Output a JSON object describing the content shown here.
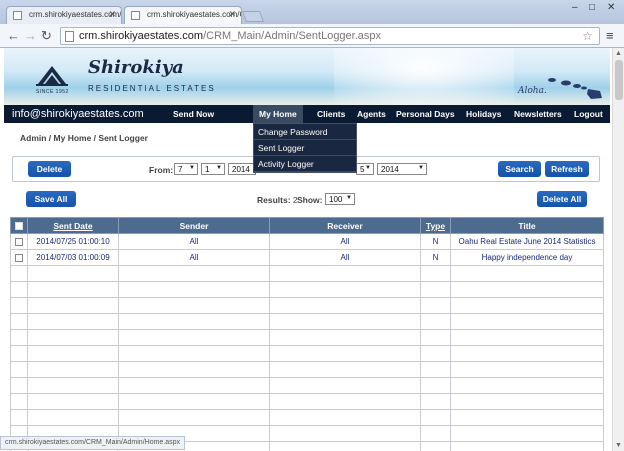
{
  "browser": {
    "tabs": [
      {
        "title": "crm.shirokiyaestates.com/CR"
      },
      {
        "title": "crm.shirokiyaestates.com/CR"
      }
    ],
    "url_host": "crm.shirokiyaestates.com",
    "url_path": "/CRM_Main/Admin/SentLogger.aspx",
    "status_url": "crm.shirokiyaestates.com/CRM_Main/Admin/Home.aspx"
  },
  "brand": {
    "name": "Shirokiya",
    "tagline": "RESIDENTIAL ESTATES",
    "since": "SINCE 1952",
    "aloha": "Aloha."
  },
  "nav": {
    "email": "info@shirokiyaestates.com",
    "items": [
      "Send Now",
      "My Home",
      "Clients",
      "Agents",
      "Personal Days",
      "Holidays",
      "Newsletters",
      "Logout"
    ],
    "active": "My Home"
  },
  "dropdown": {
    "items": [
      "Change Password",
      "Sent Logger",
      "Activity Logger"
    ]
  },
  "breadcrumb": "Admin / My Home / Sent Logger",
  "filter": {
    "delete_label": "Delete",
    "from_label": "From:",
    "from_month": "7",
    "from_day": "1",
    "from_year": "2014",
    "to_day": "5",
    "to_year": "2014",
    "search_label": "Search",
    "refresh_label": "Refresh"
  },
  "actions": {
    "save_all_label": "Save All",
    "results_label": "Results:",
    "results_count": "2",
    "show_label": "Show:",
    "show_value": "100",
    "delete_all_label": "Delete All"
  },
  "table": {
    "headers": [
      "Sent Date",
      "Sender",
      "Receiver",
      "Type",
      "Title"
    ],
    "rows": [
      {
        "sent_date": "2014/07/25 01:00:10",
        "sender": "All",
        "receiver": "All",
        "type": "N",
        "title": "Oahu Real Estate June 2014 Statistics"
      },
      {
        "sent_date": "2014/07/03 01:00:09",
        "sender": "All",
        "receiver": "All",
        "type": "N",
        "title": "Happy independence day"
      }
    ]
  },
  "colors": {
    "navbar": "#0b1a33",
    "button": "#1e5fb8",
    "table_header": "#4d6a8f",
    "cell_text": "#1b2a78"
  }
}
